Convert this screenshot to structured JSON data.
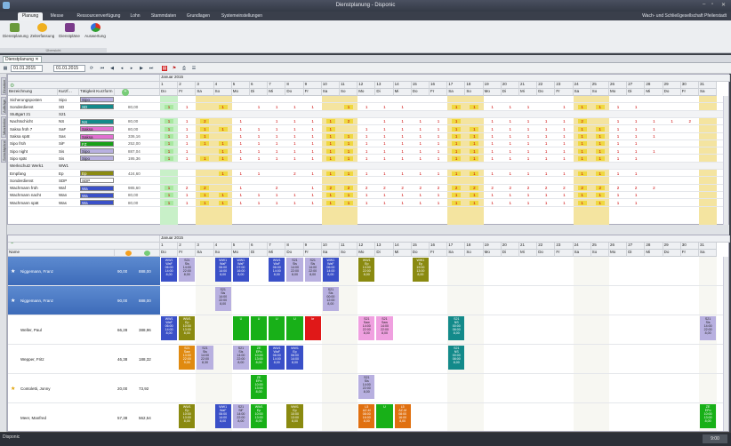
{
  "window": {
    "title": "Dienstplanung - Disponic"
  },
  "menu": {
    "tabs": [
      "Planung",
      "Messe",
      "Ressourcenverfügung",
      "Lohn",
      "Stammdaten",
      "Grundlagen",
      "Systemeinstellungen"
    ],
    "company": "Wach- und Schließgesellschaft Pfeilerstadt"
  },
  "ribbon": {
    "buttons": [
      "Dienstplanung",
      "Zeiterfassung",
      "Dienstpläne",
      "Auswertung"
    ],
    "group": "Übersicht"
  },
  "doc_tab": {
    "label": "Dienstplanung"
  },
  "toolbar": {
    "date_from": "01.01.2015",
    "date_to": "01.01.2015"
  },
  "left_strip": [
    "Einsätze",
    "Aufträge",
    "Mitarbeiter",
    "Schichtpläne"
  ],
  "month": "Januar 2015",
  "days": [
    "1",
    "2",
    "3",
    "4",
    "5",
    "6",
    "7",
    "8",
    "9",
    "10",
    "11",
    "12",
    "13",
    "14",
    "15",
    "16",
    "17",
    "18",
    "19",
    "20",
    "21",
    "22",
    "23",
    "24",
    "25",
    "26",
    "27",
    "28",
    "29",
    "30",
    "31"
  ],
  "weekdays": [
    "Do",
    "Fr",
    "Sa",
    "So",
    "Mo",
    "Di",
    "Mi",
    "Do",
    "Fr",
    "Sa",
    "So",
    "Mo",
    "Di",
    "Mi",
    "Do",
    "Fr",
    "Sa",
    "So",
    "Mo",
    "Di",
    "Mi",
    "Do",
    "Fr",
    "Sa",
    "So",
    "Mo",
    "Di",
    "Mi",
    "Do",
    "Fr",
    "Sa"
  ],
  "upper": {
    "columns": [
      "Bezeichnung",
      "Kurzf…",
      "Tätigkeit Kurzform"
    ],
    "rows": [
      {
        "name": "Sicherungsposten",
        "kurz": "Sipo",
        "act": "Sipo",
        "col": "#b8b0e0",
        "total": "",
        "group": false
      },
      {
        "name": "Sonderdienst",
        "kurz": "SD",
        "act": "SD",
        "col": "#138a8a",
        "total": "80,00",
        "group": false
      },
      {
        "name": "Stuttgart 21",
        "kurz": "S21",
        "act": "",
        "col": "",
        "total": "",
        "group": true
      },
      {
        "name": "Nachtschicht",
        "kurz": "NS",
        "act": "NS",
        "col": "#138a8a",
        "total": "80,00",
        "group": false
      },
      {
        "name": "Saksa früh 7",
        "kurz": "SaF",
        "act": "Saksa",
        "col": "#e070d0",
        "total": "80,00",
        "group": false
      },
      {
        "name": "Saksa spät",
        "kurz": "Sas",
        "act": "Saksa",
        "col": "#e070d0",
        "total": "336,16",
        "group": false
      },
      {
        "name": "Sipo früh",
        "kurz": "SiF",
        "act": "FZ",
        "col": "#18a018",
        "total": "252,00",
        "group": false
      },
      {
        "name": "Sipo night",
        "kurz": "Sis",
        "act": "Sipo",
        "col": "#b8b0e0",
        "total": "887,04",
        "group": false
      },
      {
        "name": "Sipo spät",
        "kurz": "Sis",
        "act": "Sipo",
        "col": "#b8b0e0",
        "total": "195,36",
        "group": false
      },
      {
        "name": "Werkschutz Werk1",
        "kurz": "WW1",
        "act": "",
        "col": "",
        "total": "",
        "group": true
      },
      {
        "name": "Empfang",
        "kurz": "Ep",
        "act": "Ep",
        "col": "#8a8a10",
        "total": "424,60",
        "group": false
      },
      {
        "name": "Sonderdienst",
        "kurz": "SDP",
        "act": "SDP",
        "col": "#ffffff",
        "total": "",
        "group": false
      },
      {
        "name": "Wachmann früh",
        "kurz": "Waf",
        "act": "Wa",
        "col": "#3a50c8",
        "total": "985,60",
        "group": false
      },
      {
        "name": "Wachmann nacht",
        "kurz": "Wan",
        "act": "Wa",
        "col": "#3a50c8",
        "total": "80,00",
        "group": false
      },
      {
        "name": "Wachmann spät",
        "kurz": "Was",
        "act": "Wa",
        "col": "#3a50c8",
        "total": "80,00",
        "group": false
      }
    ],
    "ones": [
      "",
      "1 1  1  1 1 1 1  1 1 1 1   1 1 1 1 1  1 1 1 1 1",
      "",
      "1 1 2  1  1 1 1 1 2  1 1 1 1 1  1 1 1 1 1 2  1 1 1 1 2",
      "1 1 1 1 1 1 1 1 1 1  1 1 1 1 1 1 1 1 1 1 1 1 1 1 1 1 1",
      "1 1 1  1 1 1 1 1 1 1 1 1 1 1 1 1 1 1 1 1 1 1 1 1 1 1 1",
      "1 1 1 1 1 1 1 1 1 1 1 1 1 1 1 1 1 1 1 1 1 1 1 1 1 1 1",
      "1 1  1 1 1 1 1 1 1 1 1 1 1 1 1 1 1 1 1 1 1 1 1 1 1 1 1",
      "1 1 1 1 1 1 1 1 1 1 1 1 1 1 1 1 1 1 1 1 1 1 1 1 1 1 1",
      "",
      "   1 1 1  2 1 1 1 1 1 1 1 1 1 1 1 1 1 1 1 1 1 1 1",
      "",
      "1 2 2  1  2  1 2 2 2 2 2 2 2 2 2 2 2 2 2 2 2 2 2 2 2",
      "1 1 1 1 1 1 1 1 1 1 1 1 1 1 1 1 1 1 1 1 1 1 1 1 1 1 1",
      "1 1 1 1 1 1 1 1 1 1 1 1 1 1 1 1 1 1 1 1 1 1 1 1 1 1 1"
    ]
  },
  "lower": {
    "columns": [
      "Name"
    ],
    "employees": [
      {
        "name": "Niggemann, Franz",
        "star": true,
        "a": "90,00",
        "b": "888,00",
        "sel": true
      },
      {
        "name": "Niggemann, Franz",
        "star": true,
        "a": "90,00",
        "b": "888,00",
        "sel": true
      },
      {
        "name": "Weller, Paul",
        "star": false,
        "a": "66,28",
        "b": "388,96",
        "sel": false
      },
      {
        "name": "Wepper, Fritz",
        "star": false,
        "a": "46,38",
        "b": "188,32",
        "sel": false
      },
      {
        "name": "Contoletti, Jonny",
        "star": true,
        "a": "20,00",
        "b": "73,92",
        "sel": false
      },
      {
        "name": "Meer, Manfred",
        "star": false,
        "a": "57,38",
        "b": "562,54",
        "sel": false
      }
    ],
    "shifts": [
      {
        "row": 0,
        "day": 0,
        "c": "#3a50c8",
        "t": "WW1 WaF 06:00 14:00 8,00"
      },
      {
        "row": 0,
        "day": 1,
        "c": "#b8b0e0",
        "t": "S21 Sis 14:00 22:00 8,00"
      },
      {
        "row": 0,
        "day": 3,
        "c": "#3a50c8",
        "t": "WW1 WaF 06:00 14:00 8,00"
      },
      {
        "row": 0,
        "day": 4,
        "c": "#3a50c8",
        "t": "WW1 WaF 07:00 16:00 8,00"
      },
      {
        "row": 0,
        "day": 6,
        "c": "#3a50c8",
        "t": "WW1 WaF 06:00 14:00 8,00"
      },
      {
        "row": 0,
        "day": 7,
        "c": "#b8b0e0",
        "t": "S21 Sis 14:00 22:00 8,00"
      },
      {
        "row": 0,
        "day": 8,
        "c": "#b8b0e0",
        "t": "S21 Sis 14:00 22:00 8,00"
      },
      {
        "row": 0,
        "day": 9,
        "c": "#3a50c8",
        "t": "WW1 WaF 06:00 14:00 8,00"
      },
      {
        "row": 0,
        "day": 11,
        "c": "#8a8a10",
        "t": "WW1 Ep 13:00 22:00 8,00"
      },
      {
        "row": 0,
        "day": 14,
        "c": "#8a8a10",
        "t": "WW1 Ep 19:00 13:00 8,00"
      },
      {
        "row": 1,
        "day": 3,
        "c": "#b8b0e0",
        "t": "S21 Sis 14:00 22:00 8,00"
      },
      {
        "row": 1,
        "day": 9,
        "c": "#b8b0e0",
        "t": "S21 Sis 00:00 12:00 8,00"
      },
      {
        "row": 2,
        "day": 0,
        "c": "#3a50c8",
        "t": "WW1 WaF 06:00 14:00 8,00"
      },
      {
        "row": 2,
        "day": 1,
        "c": "#8a8a10",
        "t": "WW1 Ep 10:00 13:00 8,00"
      },
      {
        "row": 2,
        "day": 4,
        "c": "#18b018",
        "t": "U"
      },
      {
        "row": 2,
        "day": 5,
        "c": "#18b018",
        "t": "U"
      },
      {
        "row": 2,
        "day": 6,
        "c": "#18b018",
        "t": "U"
      },
      {
        "row": 2,
        "day": 7,
        "c": "#18b018",
        "t": "U"
      },
      {
        "row": 2,
        "day": 8,
        "c": "#e01818",
        "t": "kr"
      },
      {
        "row": 2,
        "day": 11,
        "c": "#f0a0e0",
        "t": "S21 Saw 14:00 22:00 8,00"
      },
      {
        "row": 2,
        "day": 12,
        "c": "#f0a0e0",
        "t": "S21 Saw 14:00 22:00 8,00"
      },
      {
        "row": 2,
        "day": 16,
        "c": "#138a8a",
        "t": "S21 NS 00:00 08:00 8,00"
      },
      {
        "row": 2,
        "day": 30,
        "c": "#b8b0e0",
        "t": "S21 Sis 14:00 22:00 8,00"
      },
      {
        "row": 3,
        "day": 1,
        "c": "#e08a10",
        "t": "S21 Saw 13:00 22:00 9,00"
      },
      {
        "row": 3,
        "day": 2,
        "c": "#b8b0e0",
        "t": "S21 Sis 14:00 22:00 8,30"
      },
      {
        "row": 3,
        "day": 4,
        "c": "#b8b0e0",
        "t": "S21 Sis 14:00 22:00 8,00"
      },
      {
        "row": 3,
        "day": 5,
        "c": "#18b018",
        "t": "ZE EPo 10:00 13:00 8,00"
      },
      {
        "row": 3,
        "day": 6,
        "c": "#3a50c8",
        "t": "WW1 WaF 06:00 14:00 8,00"
      },
      {
        "row": 3,
        "day": 7,
        "c": "#3a50c8",
        "t": "WW1 Ep 06:00 14:00 8,00"
      },
      {
        "row": 3,
        "day": 16,
        "c": "#138a8a",
        "t": "S21 NS 00:00 08:00 8,00"
      },
      {
        "row": 4,
        "day": 5,
        "c": "#18b018",
        "t": "ZE EPo 10:00 13:00 8,00"
      },
      {
        "row": 4,
        "day": 11,
        "c": "#b8b0e0",
        "t": "S21 Sis 14:00 22:00 8,00"
      },
      {
        "row": 5,
        "day": 1,
        "c": "#8a8a10",
        "t": "WW1 Ep 10:00 13:00 8,00"
      },
      {
        "row": 5,
        "day": 3,
        "c": "#3a50c8",
        "t": "WW1 WaF 06:00 14:00 8,00"
      },
      {
        "row": 5,
        "day": 4,
        "c": "#b8b0e0",
        "t": "S21 SiF 14:00 22:00 8,00"
      },
      {
        "row": 5,
        "day": 5,
        "c": "#18b018",
        "t": "WW1 Ep 10:00 13:00 8,00"
      },
      {
        "row": 5,
        "day": 7,
        "c": "#8a8a10",
        "t": "WW1 Ep 10:00 13:00 8,00"
      },
      {
        "row": 5,
        "day": 11,
        "c": "#e07010",
        "t": "L5 AZ-M 08:00 16:00 8,00"
      },
      {
        "row": 5,
        "day": 12,
        "c": "#18b018",
        "t": "U"
      },
      {
        "row": 5,
        "day": 13,
        "c": "#e07010",
        "t": "L5 AZ-M 08:00 16:00 8,00"
      },
      {
        "row": 5,
        "day": 30,
        "c": "#18b018",
        "t": "ZE EPo 10:00 13:00 8,00"
      }
    ]
  },
  "statusbar": {
    "text": "Disponic",
    "clock": "9:00"
  },
  "colors": {
    "weekend": "#f4e4a0",
    "weekend_strong": "#f0d840",
    "today": "#c8f0c8"
  }
}
